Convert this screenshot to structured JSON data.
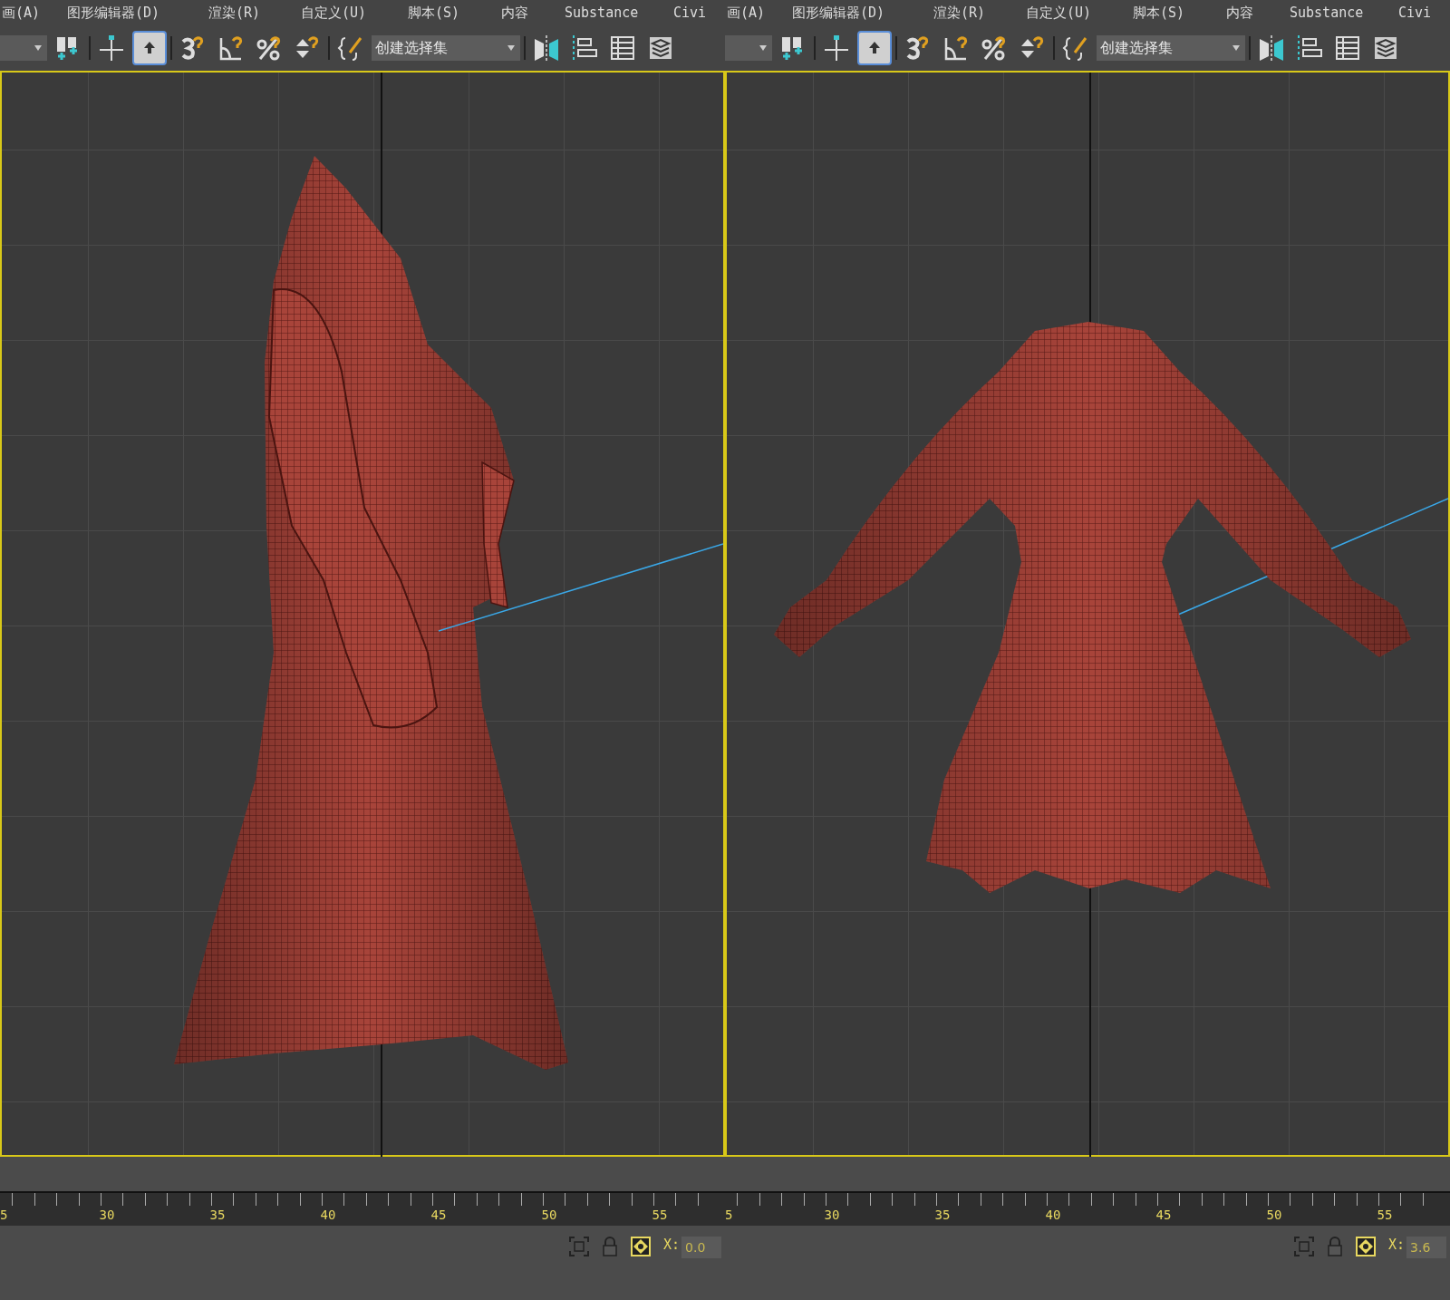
{
  "panels": [
    {
      "menu": [
        "画(A)",
        "图形编辑器(D)",
        "渲染(R)",
        "自定义(U)",
        "脚本(S)",
        "内容",
        "Substance",
        "Civi"
      ],
      "toolbar": [
        {
          "kind": "dropdown",
          "selected": false
        },
        {
          "kind": "link",
          "selected": false
        },
        {
          "kind": "move",
          "selected": false
        },
        {
          "kind": "select",
          "selected": true
        },
        {
          "kind": "snap",
          "selected": false
        },
        {
          "kind": "angle",
          "selected": false
        },
        {
          "kind": "percent",
          "selected": false
        },
        {
          "kind": "spinner",
          "selected": false
        },
        {
          "kind": "sets",
          "selected": false
        }
      ],
      "selection_set": "创建选择集",
      "tools_after": [
        {
          "kind": "mirror",
          "selected": false
        },
        {
          "kind": "align",
          "selected": false
        },
        {
          "kind": "explorer",
          "selected": false
        },
        {
          "kind": "layers",
          "selected": false
        }
      ],
      "viewport": {
        "kind": "side"
      },
      "ruler": [
        "5",
        "30",
        "35",
        "40",
        "45",
        "50",
        "55"
      ],
      "x_label": "X:",
      "x_value": "0.0"
    },
    {
      "menu": [
        "画(A)",
        "图形编辑器(D)",
        "渲染(R)",
        "自定义(U)",
        "脚本(S)",
        "内容",
        "Substance",
        "Civi"
      ],
      "toolbar": [
        {
          "kind": "dropdown",
          "selected": false
        },
        {
          "kind": "link",
          "selected": false
        },
        {
          "kind": "move",
          "selected": false
        },
        {
          "kind": "select",
          "selected": true
        },
        {
          "kind": "snap",
          "selected": false
        },
        {
          "kind": "angle",
          "selected": false
        },
        {
          "kind": "percent",
          "selected": false
        },
        {
          "kind": "spinner",
          "selected": false
        },
        {
          "kind": "sets",
          "selected": false
        }
      ],
      "selection_set": "创建选择集",
      "tools_after": [
        {
          "kind": "mirror",
          "selected": false
        },
        {
          "kind": "align",
          "selected": false
        },
        {
          "kind": "explorer",
          "selected": false
        },
        {
          "kind": "layers",
          "selected": false
        }
      ],
      "viewport": {
        "kind": "front"
      },
      "ruler": [
        "5",
        "30",
        "35",
        "40",
        "45",
        "50",
        "55"
      ],
      "x_label": "X:",
      "x_value": "3.6"
    }
  ]
}
